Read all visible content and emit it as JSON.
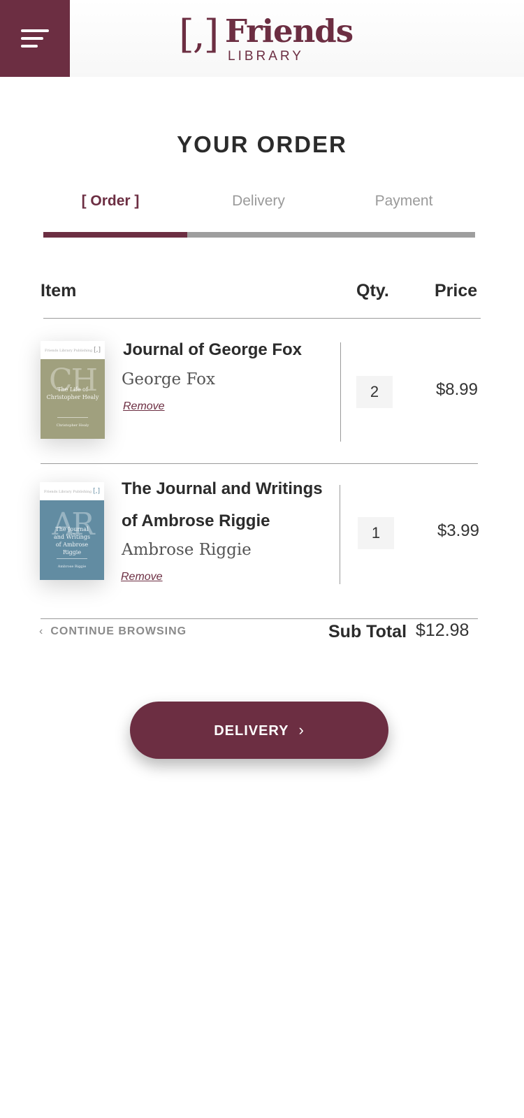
{
  "header": {
    "logo_bracket": "[,]",
    "logo_name": "Friends",
    "logo_sub": "LIBRARY",
    "brand_color": "#6c2e42"
  },
  "page": {
    "title": "YOUR ORDER"
  },
  "steps": [
    {
      "label": "[ Order ]",
      "active": true
    },
    {
      "label": "Delivery",
      "active": false
    },
    {
      "label": "Payment",
      "active": false
    }
  ],
  "progress": {
    "completed_fraction": 0.333
  },
  "table": {
    "headers": {
      "item": "Item",
      "qty": "Qty.",
      "price": "Price"
    },
    "items": [
      {
        "title": "Journal of George Fox",
        "author": "George Fox",
        "remove_label": "Remove",
        "qty": "2",
        "price": "$8.99",
        "cover": {
          "color": "#a0a07e",
          "initials": "CH",
          "title": "The Life of Christopher Healy",
          "author": "Christopher Healy",
          "series": "Friends Library Publishing",
          "badge": "[,]"
        }
      },
      {
        "title_line1": "The Journal and Writings",
        "title_line2": "of Ambrose Riggie",
        "author": "Ambrose Riggie",
        "remove_label": "Remove",
        "qty": "1",
        "price": "$3.99",
        "cover": {
          "color": "#628ca2",
          "initials": "AR",
          "title": "The Journal and Writings of Ambrose Riggie",
          "author": "Ambrose Riggie",
          "series": "Friends Library Publishing",
          "badge": "[,]"
        }
      }
    ]
  },
  "footer": {
    "continue_label": "CONTINUE BROWSING",
    "subtotal_label": "Sub Total",
    "subtotal_value": "$12.98"
  },
  "cta": {
    "label": "DELIVERY"
  }
}
